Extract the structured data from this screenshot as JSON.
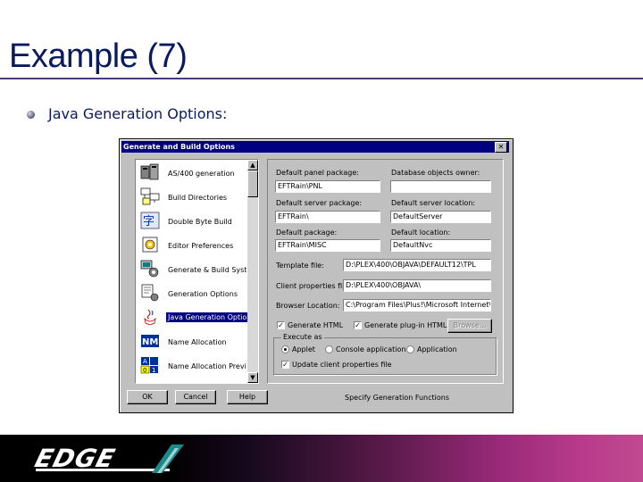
{
  "slide": {
    "title": "Example (7)",
    "bullet": "Java Generation Options:"
  },
  "dialog": {
    "title": "Generate and Build Options",
    "close_glyph": "✕",
    "list_items": [
      {
        "label": "AS/400 generation",
        "icon": "as400-icon"
      },
      {
        "label": "Build Directories",
        "icon": "build-directories-icon"
      },
      {
        "label": "Double Byte Build",
        "icon": "double-byte-icon"
      },
      {
        "label": "Editor Preferences",
        "icon": "editor-preferences-icon"
      },
      {
        "label": "Generate & Build System",
        "icon": "generate-build-system-icon"
      },
      {
        "label": "Generation Options",
        "icon": "generation-options-icon"
      },
      {
        "label": "Java Generation Options",
        "icon": "java-icon",
        "selected": true
      },
      {
        "label": "Name Allocation",
        "icon": "name-allocation-icon"
      },
      {
        "label": "Name Allocation Preview",
        "icon": "name-allocation-preview-icon"
      }
    ],
    "fields": {
      "default_panel_package": {
        "label": "Default panel package:",
        "value": "EFTRain\\PNL"
      },
      "database_objects_owner": {
        "label": "Database objects owner:",
        "value": ""
      },
      "default_server_package": {
        "label": "Default server package:",
        "value": "EFTRain\\"
      },
      "default_server_location": {
        "label": "Default server location:",
        "value": "DefaultServer"
      },
      "default_package": {
        "label": "Default package:",
        "value": "EFTRain\\MISC"
      },
      "default_location": {
        "label": "Default location:",
        "value": "DefaultNvc"
      },
      "template_file": {
        "label": "Template file:",
        "value": "D:\\PLEX\\400\\OBJAVA\\DEFAULT12\\TPL"
      },
      "client_properties_file": {
        "label": "Client properties file:",
        "value": "D:\\PLEX\\400\\OBJAVA\\"
      },
      "browser_location": {
        "label": "Browser Location:",
        "value": "C:\\Program Files\\Plus!\\Microsoft Internet\\IE"
      }
    },
    "checkboxes": {
      "generate_html": {
        "label": "Generate HTML",
        "checked": true
      },
      "generate_plugin_html": {
        "label": "Generate plug-in HTML",
        "checked": true
      },
      "update_client_properties_file": {
        "label": "Update client properties file",
        "checked": true
      }
    },
    "browse_label": "Browse...",
    "execute_as": {
      "title": "Execute as",
      "options": [
        {
          "label": "Applet",
          "selected": true
        },
        {
          "label": "Console application",
          "selected": false
        },
        {
          "label": "Application",
          "selected": false
        }
      ]
    },
    "buttons": {
      "ok": "OK",
      "cancel": "Cancel",
      "help": "Help"
    },
    "status_text": "Specify Generation Functions"
  },
  "footer": {
    "logo_text": "EDGE"
  },
  "colors": {
    "title_text": "#0a1a5c",
    "dialog_titlebar": "#000080",
    "selection": "#000080",
    "dialog_face": "#c0c0c0"
  }
}
